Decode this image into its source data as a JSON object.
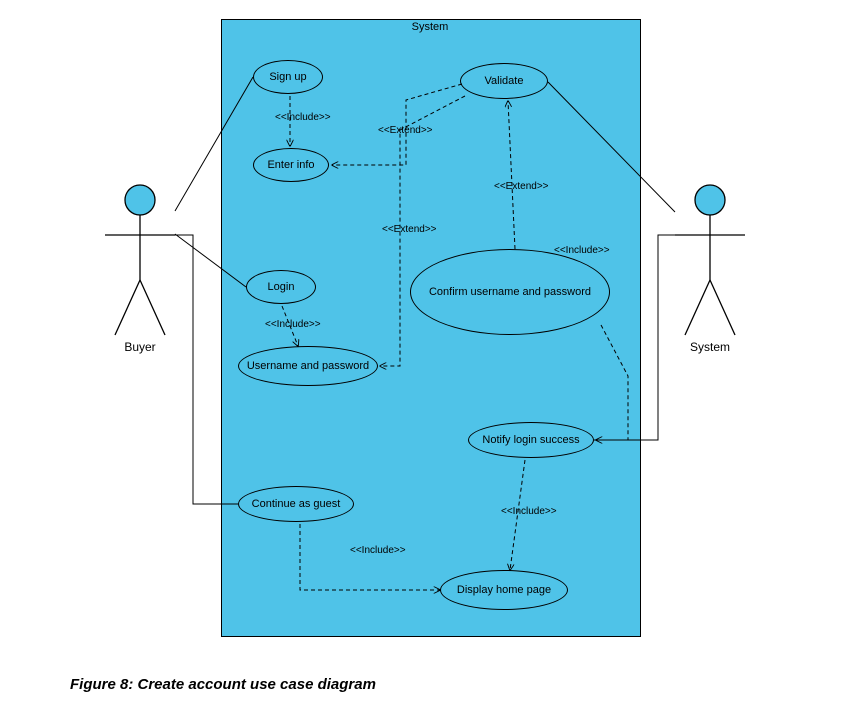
{
  "caption": "Figure 8: Create account use case diagram",
  "system_title": "System",
  "actors": {
    "buyer": "Buyer",
    "system": "System"
  },
  "usecases": {
    "signup": "Sign up",
    "enterinfo": "Enter info",
    "login": "Login",
    "userpass": "Username and password",
    "continueguest": "Continue as guest",
    "validate": "Validate",
    "confirm": "Confirm username and password",
    "notify": "Notify login success",
    "displayhome": "Display home page"
  },
  "relationships": {
    "include1": "<<Include>>",
    "extend1": "<<Extend>>",
    "extend2": "<<Extend>>",
    "extend3": "<<Extend>>",
    "include2": "<<Include>>",
    "include3": "<<Include>>",
    "include4": "<<Include>>",
    "include5": "<<Include>>"
  },
  "chart_data": {
    "type": "use-case-diagram",
    "title": "Create account use case diagram",
    "system_boundary": "System",
    "actors": [
      "Buyer",
      "System"
    ],
    "usecases": [
      "Sign up",
      "Enter info",
      "Login",
      "Username and password",
      "Continue as guest",
      "Validate",
      "Confirm username and password",
      "Notify login success",
      "Display home page"
    ],
    "associations": [
      {
        "actor": "Buyer",
        "usecase": "Sign up"
      },
      {
        "actor": "Buyer",
        "usecase": "Login"
      },
      {
        "actor": "Buyer",
        "usecase": "Continue as guest"
      },
      {
        "actor": "System",
        "usecase": "Validate"
      },
      {
        "actor": "System",
        "usecase": "Notify login success"
      }
    ],
    "relationships": [
      {
        "from": "Sign up",
        "to": "Enter info",
        "type": "include"
      },
      {
        "from": "Validate",
        "to": "Enter info",
        "type": "extend"
      },
      {
        "from": "Validate",
        "to": "Username and password",
        "type": "extend"
      },
      {
        "from": "Confirm username and password",
        "to": "Validate",
        "type": "extend"
      },
      {
        "from": "Login",
        "to": "Username and password",
        "type": "include"
      },
      {
        "from": "Confirm username and password",
        "to": "Notify login success",
        "type": "include"
      },
      {
        "from": "Continue as guest",
        "to": "Display home page",
        "type": "include"
      },
      {
        "from": "Notify login success",
        "to": "Display home page",
        "type": "include"
      }
    ]
  }
}
